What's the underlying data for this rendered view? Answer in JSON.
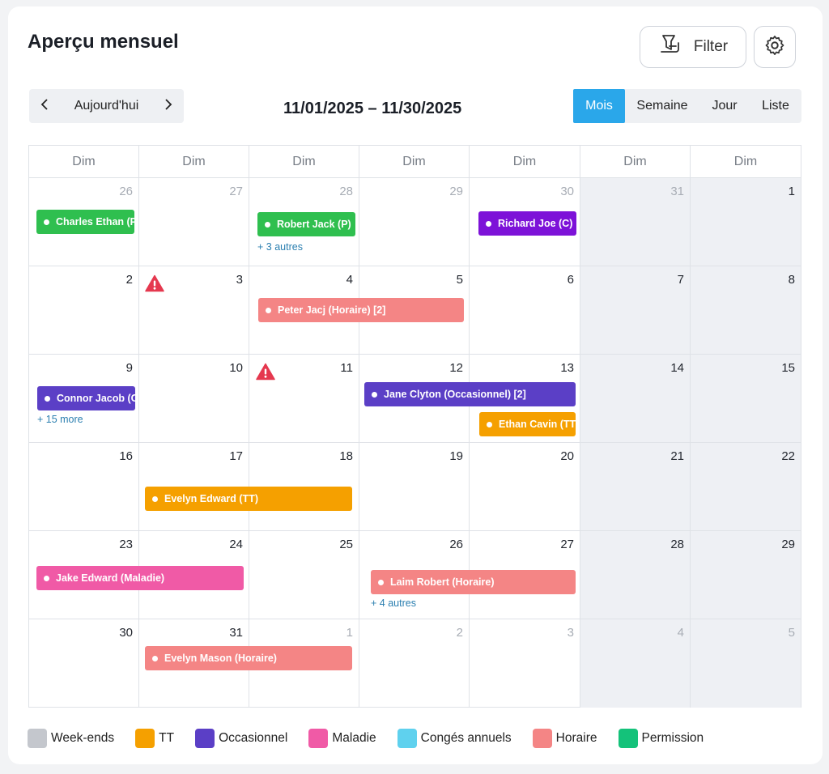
{
  "header": {
    "title": "Aperçu mensuel",
    "filter_label": "Filter"
  },
  "toolbar": {
    "today_label": "Aujourd'hui",
    "date_range": "11/01/2025 – 11/30/2025"
  },
  "views": [
    "Mois",
    "Semaine",
    "Jour",
    "Liste"
  ],
  "active_view": "Mois",
  "weekday_headers": [
    "Dim",
    "Dim",
    "Dim",
    "Dim",
    "Dim",
    "Dim",
    "Dim"
  ],
  "weeks": [
    [
      "26",
      "27",
      "28",
      "29",
      "30",
      "31",
      "1"
    ],
    [
      "2",
      "3",
      "4",
      "5",
      "6",
      "7",
      "8"
    ],
    [
      "9",
      "10",
      "11",
      "12",
      "13",
      "14",
      "15"
    ],
    [
      "16",
      "17",
      "18",
      "19",
      "20",
      "21",
      "22"
    ],
    [
      "23",
      "24",
      "25",
      "26",
      "27",
      "28",
      "29"
    ],
    [
      "30",
      "31",
      "1",
      "2",
      "3",
      "4",
      "5"
    ]
  ],
  "events": [
    {
      "label": "Charles Ethan (P",
      "color": "#2fbf4f"
    },
    {
      "label": "Robert Jack (P)",
      "color": "#2fbf4f"
    },
    {
      "label": "Richard Joe (C)",
      "color": "#7d12d8"
    },
    {
      "label": "Peter Jacj (Horaire) [2]",
      "color": "#f48585"
    },
    {
      "label": "Connor Jacob (O",
      "color": "#5b3fc6"
    },
    {
      "label": "Jane Clyton (Occasionnel) [2]",
      "color": "#5b3fc6"
    },
    {
      "label": "Ethan Cavin (TT",
      "color": "#f5a000"
    },
    {
      "label": "Evelyn Edward (TT)",
      "color": "#f5a000"
    },
    {
      "label": "Jake Edward (Maladie)",
      "color": "#f05aa6"
    },
    {
      "label": "Laim Robert (Horaire)",
      "color": "#f48585"
    },
    {
      "label": "Evelyn Mason (Horaire)",
      "color": "#f48585"
    }
  ],
  "more_links": [
    "+ 3 autres",
    "+ 15 more",
    "+ 4 autres"
  ],
  "legend": [
    {
      "label": "Week-ends",
      "color": "#c4c7cd"
    },
    {
      "label": "TT",
      "color": "#f5a000"
    },
    {
      "label": "Occasionnel",
      "color": "#5b3fc6"
    },
    {
      "label": "Maladie",
      "color": "#f05aa6"
    },
    {
      "label": "Congés annuels",
      "color": "#5fd1ee"
    },
    {
      "label": "Horaire",
      "color": "#f48585"
    },
    {
      "label": "Permission",
      "color": "#14c27a"
    }
  ],
  "icons": {
    "filter": "filter-icon",
    "settings": "gear-icon",
    "prev": "chevron-left-icon",
    "next": "chevron-right-icon",
    "warning": "warning-icon"
  }
}
